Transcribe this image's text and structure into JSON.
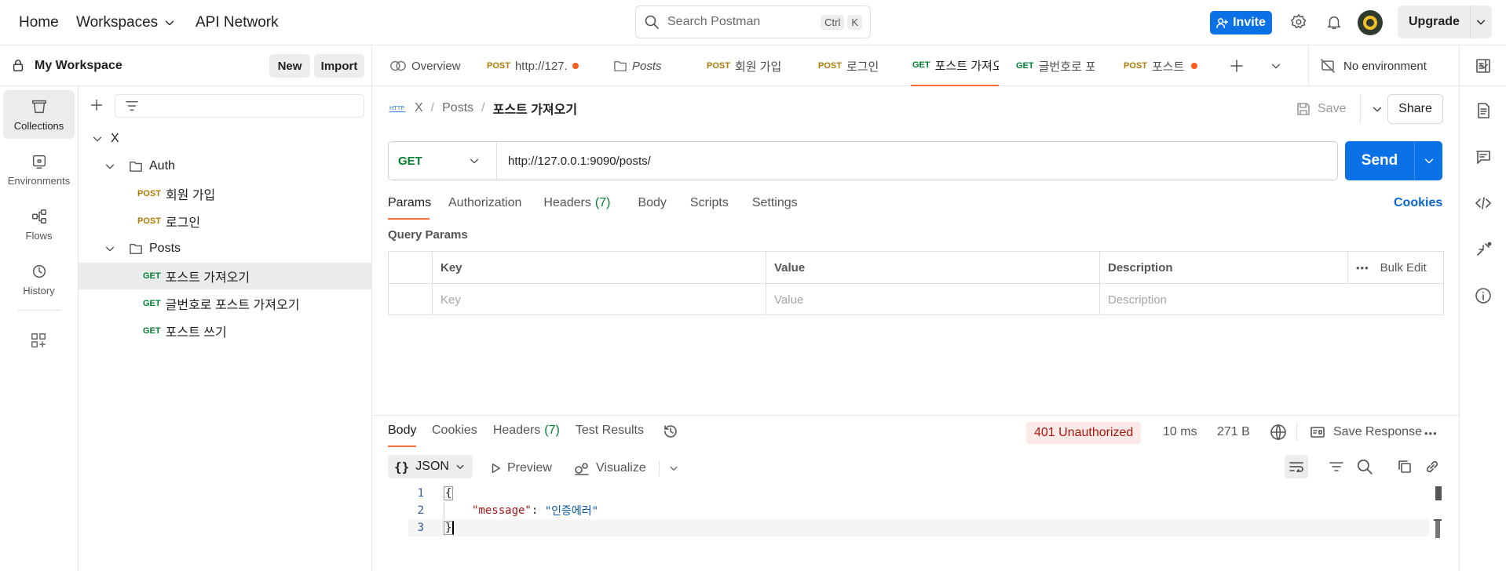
{
  "topbar": {
    "home": "Home",
    "workspaces": "Workspaces",
    "api_network": "API Network",
    "search_placeholder": "Search Postman",
    "shortcut_ctrl": "Ctrl",
    "shortcut_k": "K",
    "invite": "Invite",
    "upgrade": "Upgrade"
  },
  "workspace": {
    "title": "My Workspace",
    "new": "New",
    "import": "Import"
  },
  "rail": [
    {
      "label": "Collections",
      "icon": "collections-icon",
      "active": true
    },
    {
      "label": "Environments",
      "icon": "environments-icon",
      "active": false
    },
    {
      "label": "Flows",
      "icon": "flows-icon",
      "active": false
    },
    {
      "label": "History",
      "icon": "history-icon",
      "active": false
    }
  ],
  "tree": {
    "collection": "X",
    "auth_folder": "Auth",
    "auth_items": [
      {
        "method": "POST",
        "name": "회원 가입"
      },
      {
        "method": "POST",
        "name": "로그인"
      }
    ],
    "posts_folder": "Posts",
    "posts_items": [
      {
        "method": "GET",
        "name": "포스트 가져오기"
      },
      {
        "method": "GET",
        "name": "글번호로 포스트 가져오기"
      },
      {
        "method": "GET",
        "name": "포스트 쓰기"
      }
    ]
  },
  "tabs": [
    {
      "method": "",
      "label": "Overview"
    },
    {
      "method": "POST",
      "label": "http://127."
    },
    {
      "method": "",
      "label": "Posts"
    },
    {
      "method": "POST",
      "label": "회원 가입"
    },
    {
      "method": "POST",
      "label": "로그인"
    },
    {
      "method": "GET",
      "label": "포스트 가져오"
    },
    {
      "method": "GET",
      "label": "글번호로 포스"
    },
    {
      "method": "POST",
      "label": "포스트 쓰기"
    }
  ],
  "environment": "No environment",
  "request": {
    "breadcrumb": [
      "X",
      "Posts",
      "포스트 가져오기"
    ],
    "save": "Save",
    "share": "Share",
    "method": "GET",
    "url": "http://127.0.0.1:9090/posts/",
    "send": "Send",
    "tabs": [
      "Params",
      "Authorization",
      "Headers",
      "Body",
      "Scripts",
      "Settings"
    ],
    "headers_count": "(7)",
    "cookies": "Cookies",
    "query_params_title": "Query Params",
    "columns": [
      "Key",
      "Value",
      "Description"
    ],
    "bulk_edit": "Bulk Edit",
    "placeholders": [
      "Key",
      "Value",
      "Description"
    ]
  },
  "response": {
    "tabs": [
      "Body",
      "Cookies",
      "Headers",
      "Test Results"
    ],
    "headers_count": "(7)",
    "status": "401 Unauthorized",
    "time": "10 ms",
    "size": "271 B",
    "save_response": "Save Response",
    "format": "JSON",
    "preview": "Preview",
    "visualize": "Visualize",
    "lines": [
      "1",
      "2",
      "3"
    ],
    "open_brace": "{",
    "key": "\"message\"",
    "colon": ": ",
    "value": "\"인증에러\"",
    "close_brace": "}"
  }
}
